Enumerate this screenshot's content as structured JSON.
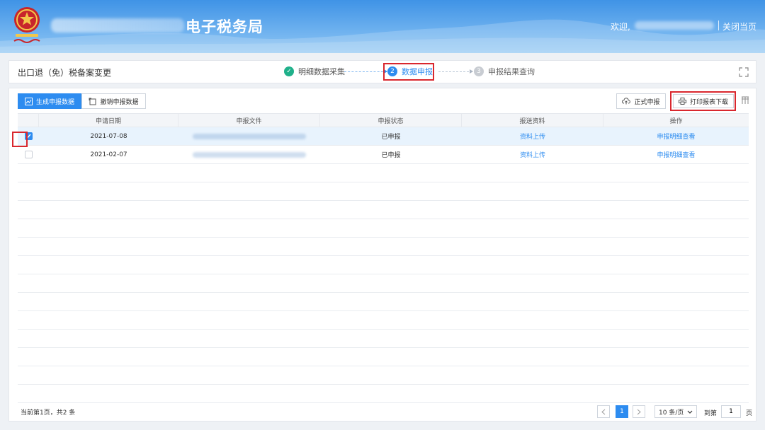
{
  "header": {
    "brand_title": "电子税务局",
    "welcome": "欢迎,",
    "close_page": "关闭当页"
  },
  "titlebar": {
    "page_title": "出口退（免）税备案变更",
    "steps": [
      {
        "num": "✓",
        "label": "明细数据采集"
      },
      {
        "num": "2",
        "label": "数据申报"
      },
      {
        "num": "3",
        "label": "申报结果查询"
      }
    ]
  },
  "toolbar": {
    "generate_label": "生成申报数据",
    "revoke_label": "撤销申报数据",
    "formal_label": "正式申报",
    "print_label": "打印报表下载"
  },
  "table": {
    "columns": [
      "申请日期",
      "申报文件",
      "申报状态",
      "报送资料",
      "操作"
    ],
    "rows": [
      {
        "date": "2021-07-08",
        "status": "已申报",
        "upload": "资料上传",
        "action": "申报明细查看",
        "checked": true
      },
      {
        "date": "2021-02-07",
        "status": "已申报",
        "upload": "资料上传",
        "action": "申报明细查看",
        "checked": false
      }
    ]
  },
  "footer": {
    "info": "当前第1页，共2 条",
    "current_page": "1",
    "page_size": "10 条/页",
    "goto_label": "到第",
    "goto_value": "1",
    "goto_suffix": "页"
  },
  "colors": {
    "accent": "#2d8cf0",
    "highlight": "#d9272e",
    "done": "#1fb08a"
  }
}
